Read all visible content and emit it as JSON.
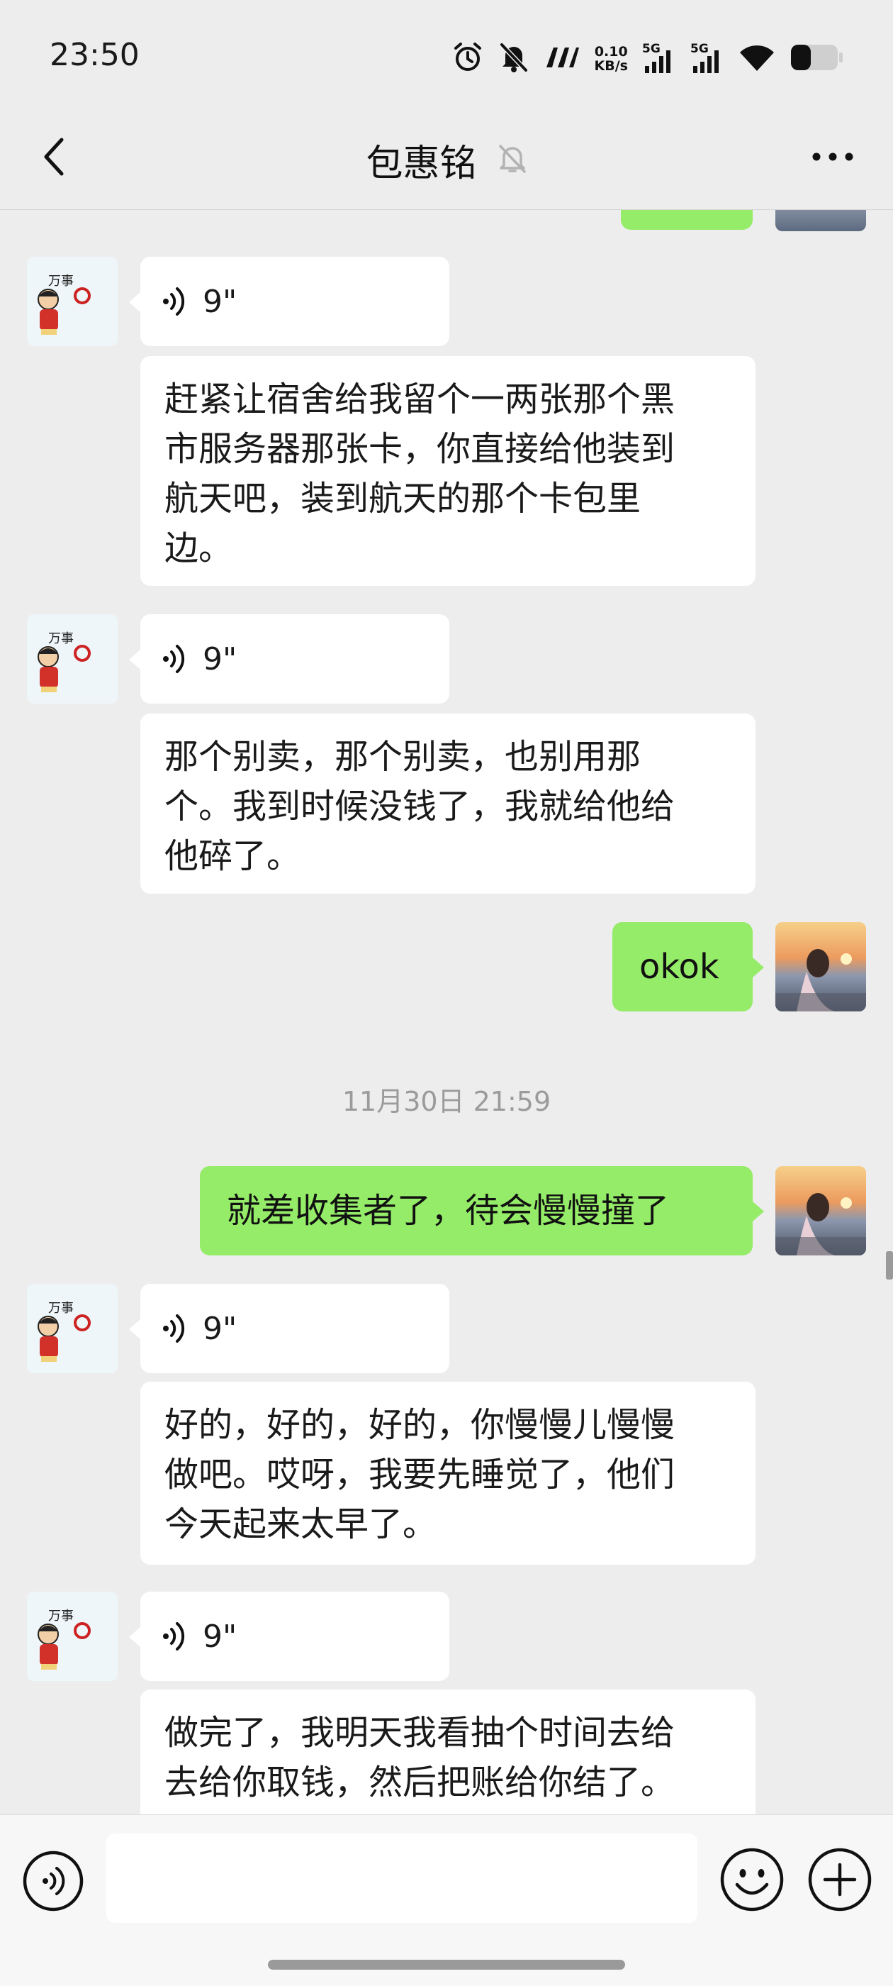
{
  "status_bar": {
    "time": "23:50",
    "net_speed_value": "0.10",
    "net_speed_unit": "KB/s",
    "signal1_label": "5G",
    "signal2_label": "5G",
    "icons": [
      "alarm-icon",
      "bell-off-icon",
      "nfc-icon",
      "signal-icon",
      "signal-icon",
      "wifi-icon",
      "battery-icon"
    ],
    "battery_level": 0.4
  },
  "header": {
    "title": "包惠铭",
    "back_icon": "chevron-left-icon",
    "mute_icon": "bell-off-icon",
    "more_icon": "more-dots-icon"
  },
  "messages": [
    {
      "sender": "me",
      "type": "text",
      "text": ""
    },
    {
      "sender": "other",
      "type": "voice",
      "duration": "9\""
    },
    {
      "sender": "other",
      "type": "text",
      "lines": [
        "赶紧让宿舍给我留个一两张那个黑",
        "市服务器那张卡，你直接给他装到",
        "航天吧，装到航天的那个卡包里",
        "边。"
      ]
    },
    {
      "sender": "other",
      "type": "voice",
      "duration": "9\""
    },
    {
      "sender": "other",
      "type": "text",
      "lines": [
        "那个别卖，那个别卖，也别用那",
        "个。我到时候没钱了，我就给他给",
        "他碎了。"
      ]
    },
    {
      "sender": "me",
      "type": "text",
      "text": "okok"
    },
    {
      "type": "timestamp",
      "text": "11月30日 21:59"
    },
    {
      "sender": "me",
      "type": "text",
      "text": "就差收集者了，待会慢慢撞了"
    },
    {
      "sender": "other",
      "type": "voice",
      "duration": "9\""
    },
    {
      "sender": "other",
      "type": "text",
      "lines": [
        "好的，好的，好的，你慢慢儿慢慢",
        "做吧。哎呀，我要先睡觉了，他们",
        "今天起来太早了。"
      ]
    },
    {
      "sender": "other",
      "type": "voice",
      "duration": "9\""
    },
    {
      "sender": "other",
      "type": "text",
      "lines": [
        "做完了，我明天我看抽个时间去给",
        "去给你取钱，然后把账给你结了。"
      ]
    }
  ],
  "input_bar": {
    "voice_icon": "voice-input-icon",
    "text_value": "",
    "emoji_icon": "emoji-icon",
    "plus_icon": "plus-icon"
  },
  "colors": {
    "background": "#ededed",
    "bubble_self": "#95ec69",
    "bubble_other": "#ffffff",
    "timestamp_text": "#9b9b9b"
  }
}
